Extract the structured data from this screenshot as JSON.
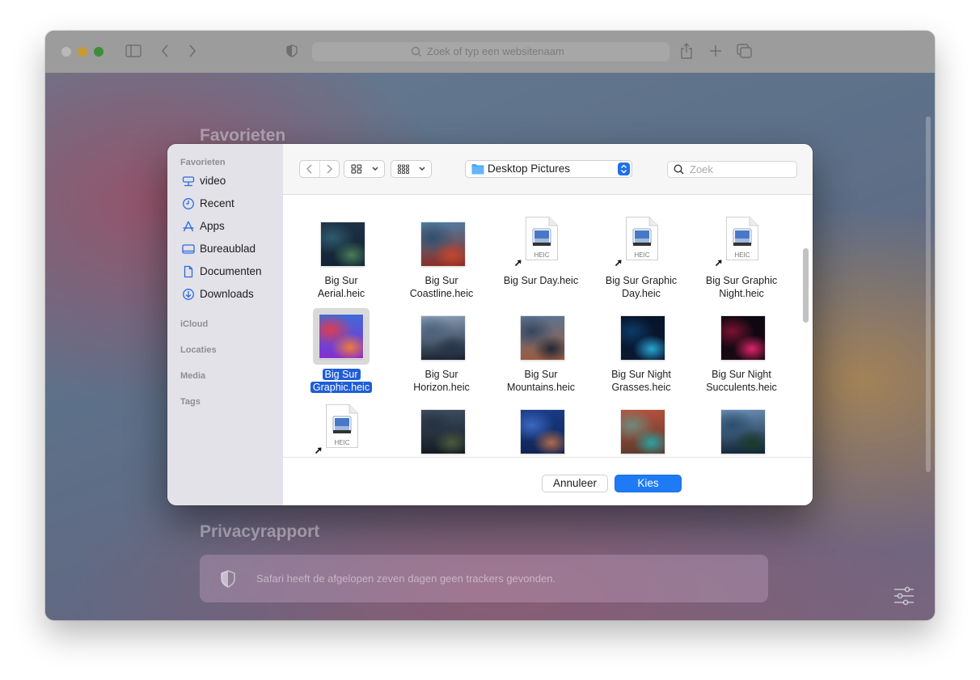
{
  "browser": {
    "address_placeholder": "Zoek of typ een websitenaam",
    "icons": [
      "sidebar-icon",
      "back-icon",
      "forward-icon",
      "shield-icon",
      "share-icon",
      "new-tab-icon",
      "tabs-overview-icon"
    ]
  },
  "start_page": {
    "favorites_heading": "Favorieten",
    "privacy_heading": "Privacyrapport",
    "privacy_message": "Safari heeft de afgelopen zeven dagen geen trackers gevonden."
  },
  "dialog": {
    "sidebar": {
      "favorites_label": "Favorieten",
      "items": [
        {
          "label": "video",
          "icon": "video-drive-icon"
        },
        {
          "label": "Recent",
          "icon": "clock-icon"
        },
        {
          "label": "Apps",
          "icon": "apps-icon"
        },
        {
          "label": "Bureaublad",
          "icon": "desktop-icon"
        },
        {
          "label": "Documenten",
          "icon": "document-icon"
        },
        {
          "label": "Downloads",
          "icon": "download-icon"
        }
      ],
      "icloud_label": "iCloud",
      "locations_label": "Locaties",
      "media_label": "Media",
      "tags_label": "Tags"
    },
    "location": "Desktop Pictures",
    "search_placeholder": "Zoek",
    "cancel_label": "Annuleer",
    "choose_label": "Kies",
    "heic_label": "HEIC",
    "files": [
      {
        "name": "Big Sur Aerial.heic",
        "line1": "Big Sur",
        "line2": "Aerial.heic",
        "kind": "photo",
        "colors": [
          "#1f3346",
          "#2d5b6d",
          "#4a7c5a",
          "#112233"
        ]
      },
      {
        "name": "Big Sur Coastline.heic",
        "line1": "Big Sur",
        "line2": "Coastline.heic",
        "kind": "photo",
        "colors": [
          "#4d7fa6",
          "#2f4f6e",
          "#c5472f",
          "#8d2a1e"
        ]
      },
      {
        "name": "Big Sur Day.heic",
        "line1": "Big Sur Day.heic",
        "line2": "",
        "kind": "heic-alias"
      },
      {
        "name": "Big Sur Graphic Day.heic",
        "line1": "Big Sur Graphic",
        "line2": "Day.heic",
        "kind": "heic-alias"
      },
      {
        "name": "Big Sur Graphic Night.heic",
        "line1": "Big Sur Graphic",
        "line2": "Night.heic",
        "kind": "heic-alias"
      },
      {
        "name": "Big Sur Graphic.heic",
        "line1": "Big Sur",
        "line2": "Graphic.heic",
        "kind": "photo",
        "selected": true,
        "colors": [
          "#3a6fd6",
          "#e03a4f",
          "#f07a3a",
          "#8a2ad0"
        ]
      },
      {
        "name": "Big Sur Horizon.heic",
        "line1": "Big Sur",
        "line2": "Horizon.heic",
        "kind": "photo",
        "colors": [
          "#8aa0b8",
          "#4d627c",
          "#27354a",
          "#151d2a"
        ]
      },
      {
        "name": "Big Sur Mountains.heic",
        "line1": "Big Sur",
        "line2": "Mountains.heic",
        "kind": "photo",
        "colors": [
          "#5a7596",
          "#33475f",
          "#1d2837",
          "#9c5a3a"
        ]
      },
      {
        "name": "Big Sur Night Grasses.heic",
        "line1": "Big Sur Night",
        "line2": "Grasses.heic",
        "kind": "photo",
        "colors": [
          "#061428",
          "#0d3a6a",
          "#29a6d8",
          "#0a1a33"
        ]
      },
      {
        "name": "Big Sur Night Succulents.heic",
        "line1": "Big Sur Night",
        "line2": "Succulents.heic",
        "kind": "photo",
        "colors": [
          "#0b0710",
          "#7a1230",
          "#e0246a",
          "#1a0a14"
        ]
      },
      {
        "name": "",
        "line1": "",
        "line2": "",
        "kind": "heic-alias"
      },
      {
        "name": "",
        "line1": "",
        "line2": "",
        "kind": "photo",
        "colors": [
          "#3d4f63",
          "#27323f",
          "#4b5a3d",
          "#12171f"
        ]
      },
      {
        "name": "",
        "line1": "",
        "line2": "",
        "kind": "photo",
        "colors": [
          "#1a3d8a",
          "#3c67c2",
          "#b06a4a",
          "#0f2350"
        ]
      },
      {
        "name": "",
        "line1": "",
        "line2": "",
        "kind": "photo",
        "colors": [
          "#b8523d",
          "#6e8a7c",
          "#2aa3a0",
          "#5a3a2e"
        ]
      },
      {
        "name": "",
        "line1": "",
        "line2": "",
        "kind": "photo",
        "colors": [
          "#6a8fb5",
          "#2a4f6e",
          "#1b3a2a",
          "#0f2233"
        ]
      }
    ]
  }
}
